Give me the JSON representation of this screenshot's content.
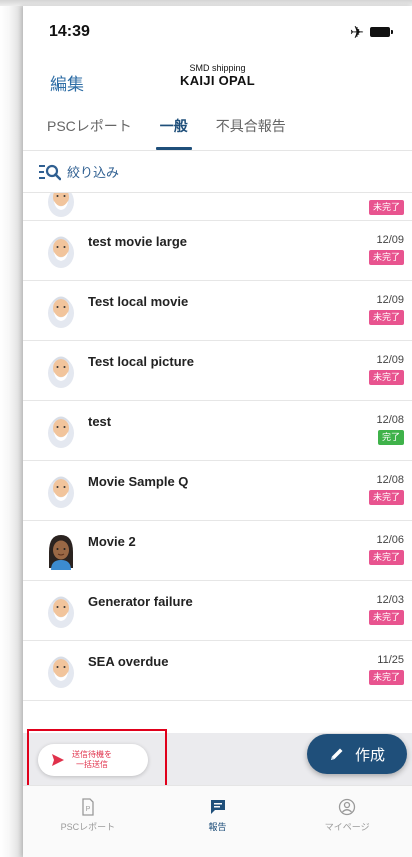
{
  "status_bar": {
    "time": "14:39",
    "airplane_icon": "airplane-icon",
    "battery_icon": "battery-icon"
  },
  "nav": {
    "edit_label": "編集",
    "subtitle": "SMD shipping",
    "title": "KAIJI OPAL"
  },
  "tabs": [
    {
      "label": "PSCレポート",
      "active": false
    },
    {
      "label": "一般",
      "active": true
    },
    {
      "label": "不具合報告",
      "active": false
    }
  ],
  "filter": {
    "label": "絞り込み",
    "icon": "filter-search-icon"
  },
  "report_list": [
    {
      "title": "",
      "date": "",
      "status": "未完了",
      "status_color": "#e8548f",
      "avatar": "elderly-man"
    },
    {
      "title": "test movie large",
      "date": "12/09",
      "status": "未完了",
      "status_color": "#e8548f",
      "avatar": "elderly-man"
    },
    {
      "title": "Test local movie",
      "date": "12/09",
      "status": "未完了",
      "status_color": "#e8548f",
      "avatar": "elderly-man"
    },
    {
      "title": "Test local picture",
      "date": "12/09",
      "status": "未完了",
      "status_color": "#e8548f",
      "avatar": "elderly-man"
    },
    {
      "title": "test",
      "date": "12/08",
      "status": "完了",
      "status_color": "#3fb24a",
      "avatar": "elderly-man"
    },
    {
      "title": "Movie Sample Q",
      "date": "12/08",
      "status": "未完了",
      "status_color": "#e8548f",
      "avatar": "elderly-man"
    },
    {
      "title": "Movie 2",
      "date": "12/06",
      "status": "未完了",
      "status_color": "#e8548f",
      "avatar": "woman"
    },
    {
      "title": "Generator failure",
      "date": "12/03",
      "status": "未完了",
      "status_color": "#e8548f",
      "avatar": "elderly-man"
    },
    {
      "title": "SEA overdue",
      "date": "11/25",
      "status": "未完了",
      "status_color": "#e8548f",
      "avatar": "elderly-man"
    }
  ],
  "send_button": {
    "line1": "送信待機を",
    "line2": "一括送信",
    "icon": "send-icon"
  },
  "fab": {
    "label": "作成",
    "icon": "pencil-icon"
  },
  "bottom_tabs": [
    {
      "label": "PSCレポート",
      "icon": "document-icon",
      "active": false
    },
    {
      "label": "報告",
      "icon": "chat-icon",
      "active": true
    },
    {
      "label": "マイページ",
      "icon": "user-icon",
      "active": false
    }
  ],
  "colors": {
    "accent": "#1f4f7a",
    "link": "#2f6ea6",
    "incomplete": "#e8548f",
    "complete": "#3fb24a",
    "highlight": "#e0001b"
  }
}
